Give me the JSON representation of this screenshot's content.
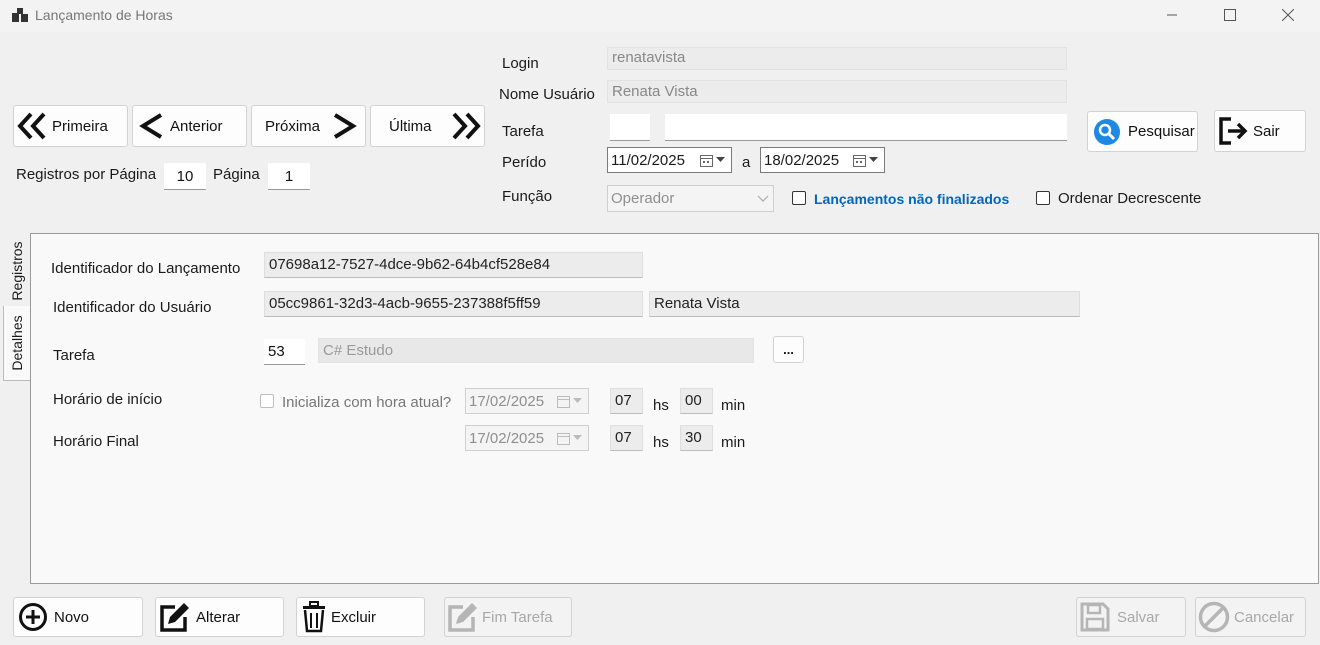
{
  "window": {
    "title": "Lançamento de Horas"
  },
  "nav": {
    "first": "Primeira",
    "previous": "Anterior",
    "next": "Próxima",
    "last": "Última",
    "per_page_label": "Registros por Página",
    "per_page_value": "10",
    "page_label": "Página",
    "page_value": "1"
  },
  "filters": {
    "login_label": "Login",
    "login_value": "renatavista",
    "user_name_label": "Nome Usuário",
    "user_name_value": "Renata Vista",
    "task_label": "Tarefa",
    "task_code": "",
    "task_name": "",
    "period_label": "Perído",
    "period_from": "11/02/2025",
    "period_sep": "a",
    "period_to": "18/02/2025",
    "function_label": "Função",
    "function_value": "Operador",
    "unfinished_label": "Lançamentos não finalizados",
    "desc_order_label": "Ordenar Decrescente",
    "search_button": "Pesquisar",
    "exit_button": "Sair"
  },
  "tabs": {
    "records": "Registros",
    "details": "Detalhes"
  },
  "details": {
    "entry_id_label": "Identificador do Lançamento",
    "entry_id_value": "07698a12-7527-4dce-9b62-64b4cf528e84",
    "user_id_label": "Identificador do Usuário",
    "user_id_value": "05cc9861-32d3-4acb-9655-237388f5ff59",
    "user_name_value": "Renata Vista",
    "task_label": "Tarefa",
    "task_code": "53",
    "task_name": "C# Estudo",
    "task_browse": "...",
    "start_label": "Horário de início",
    "start_now_label": "Inicializa com hora atual?",
    "start_date": "17/02/2025",
    "start_hour": "07",
    "start_min": "00",
    "end_label": "Horário Final",
    "end_date": "17/02/2025",
    "end_hour": "07",
    "end_min": "30",
    "hs": "hs",
    "min": "min"
  },
  "actions": {
    "new": "Novo",
    "edit": "Alterar",
    "delete": "Excluir",
    "finish_task": "Fim Tarefa",
    "save": "Salvar",
    "cancel": "Cancelar"
  },
  "colors": {
    "accent_blue": "#0067c0",
    "search_icon_blue": "#1e88e5"
  }
}
